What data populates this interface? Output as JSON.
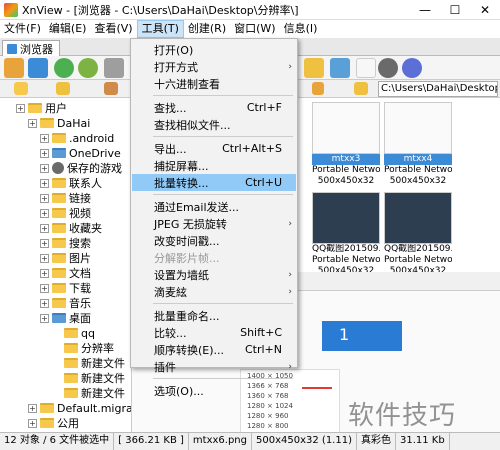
{
  "window": {
    "title": "XnView - [浏览器 - C:\\Users\\DaHai\\Desktop\\分辨率\\]",
    "min": "—",
    "max": "☐",
    "close": "✕"
  },
  "menubar": [
    "文件(F)",
    "编辑(E)",
    "查看(V)",
    "工具(T)",
    "创建(R)",
    "窗口(W)",
    "信息(I)"
  ],
  "tab": "浏览器",
  "path": "C:\\Users\\DaHai\\Desktop\\",
  "tree": [
    {
      "label": "用户",
      "indent": 1,
      "type": "folder"
    },
    {
      "label": "DaHai",
      "indent": 2,
      "type": "folder"
    },
    {
      "label": ".android",
      "indent": 3,
      "type": "folder"
    },
    {
      "label": "OneDrive",
      "indent": 3,
      "type": "blue"
    },
    {
      "label": "保存的游戏",
      "indent": 3,
      "type": "gear"
    },
    {
      "label": "联系人",
      "indent": 3,
      "type": "folder"
    },
    {
      "label": "链接",
      "indent": 3,
      "type": "folder"
    },
    {
      "label": "视频",
      "indent": 3,
      "type": "folder"
    },
    {
      "label": "收藏夹",
      "indent": 3,
      "type": "folder"
    },
    {
      "label": "搜索",
      "indent": 3,
      "type": "folder"
    },
    {
      "label": "图片",
      "indent": 3,
      "type": "folder"
    },
    {
      "label": "文档",
      "indent": 3,
      "type": "folder"
    },
    {
      "label": "下载",
      "indent": 3,
      "type": "folder"
    },
    {
      "label": "音乐",
      "indent": 3,
      "type": "folder"
    },
    {
      "label": "桌面",
      "indent": 3,
      "type": "blue"
    },
    {
      "label": "qq",
      "indent": 4,
      "type": "folder"
    },
    {
      "label": "分辨率",
      "indent": 4,
      "type": "folder"
    },
    {
      "label": "新建文件",
      "indent": 4,
      "type": "folder"
    },
    {
      "label": "新建文件",
      "indent": 4,
      "type": "folder"
    },
    {
      "label": "新建文件",
      "indent": 4,
      "type": "folder"
    },
    {
      "label": "Default.migrat",
      "indent": 2,
      "type": "folder"
    },
    {
      "label": "公用",
      "indent": 2,
      "type": "folder"
    }
  ],
  "thumbnails": [
    {
      "name": "",
      "format": "Portable Network Gr...",
      "size": "500x450x32",
      "selected": true
    },
    {
      "name": "mtxx3",
      "format": "Portable Network Gr...",
      "size": "500x450x32",
      "selected": true
    },
    {
      "name": "mtxx4",
      "format": "Portable Network Gr...",
      "size": "500x450x32",
      "selected": true
    },
    {
      "name": "QQ截图201509...",
      "format": "Portable Network Gr...",
      "size": "500x450x32",
      "selected": false
    },
    {
      "name": "QQ截图201509...",
      "format": "Portable Network Gr...",
      "size": "500x450x32",
      "selected": false
    }
  ],
  "preview": {
    "number": "1",
    "resolutions": [
      "1400 × 1050",
      "1366 × 768",
      "1360 × 768",
      "1280 × 1024",
      "1280 × 960",
      "1280 × 800"
    ]
  },
  "dropdown": [
    {
      "label": "打开(O)",
      "shortcut": "",
      "submenu": false
    },
    {
      "label": "打开方式",
      "shortcut": "",
      "submenu": true
    },
    {
      "label": "十六进制查看",
      "shortcut": "",
      "submenu": false
    },
    {
      "sep": true
    },
    {
      "label": "查找...",
      "shortcut": "Ctrl+F",
      "submenu": false
    },
    {
      "label": "查找相似文件...",
      "shortcut": "",
      "submenu": false
    },
    {
      "sep": true
    },
    {
      "label": "导出...",
      "shortcut": "Ctrl+Alt+S",
      "submenu": false
    },
    {
      "label": "捕捉屏幕...",
      "shortcut": "",
      "submenu": false
    },
    {
      "label": "批量转换...",
      "shortcut": "Ctrl+U",
      "submenu": false,
      "highlight": true
    },
    {
      "sep": true
    },
    {
      "label": "通过Email发送...",
      "shortcut": "",
      "submenu": false
    },
    {
      "label": "JPEG 无损旋转",
      "shortcut": "",
      "submenu": true
    },
    {
      "label": "改变时间戳...",
      "shortcut": "",
      "submenu": false
    },
    {
      "label": "分解影片帧...",
      "shortcut": "",
      "submenu": false,
      "disabled": true
    },
    {
      "label": "设置为墙纸",
      "shortcut": "",
      "submenu": true
    },
    {
      "label": "滴麦絃",
      "shortcut": "",
      "submenu": true
    },
    {
      "sep": true
    },
    {
      "label": "批量重命名...",
      "shortcut": "",
      "submenu": false
    },
    {
      "label": "比较...",
      "shortcut": "Shift+C",
      "submenu": false
    },
    {
      "label": "顺序转换(E)...",
      "shortcut": "Ctrl+N",
      "submenu": false
    },
    {
      "label": "插件",
      "shortcut": "",
      "submenu": true
    },
    {
      "sep": true
    },
    {
      "label": "选项(O)...",
      "shortcut": "",
      "submenu": false
    }
  ],
  "status": [
    "12 对象 / 6 文件被选中",
    "[ 366.21 KB ]",
    "mtxx6.png",
    "500x450x32 (1.11)",
    "真彩色",
    "31.11 Kb"
  ],
  "watermark": "软件技巧"
}
